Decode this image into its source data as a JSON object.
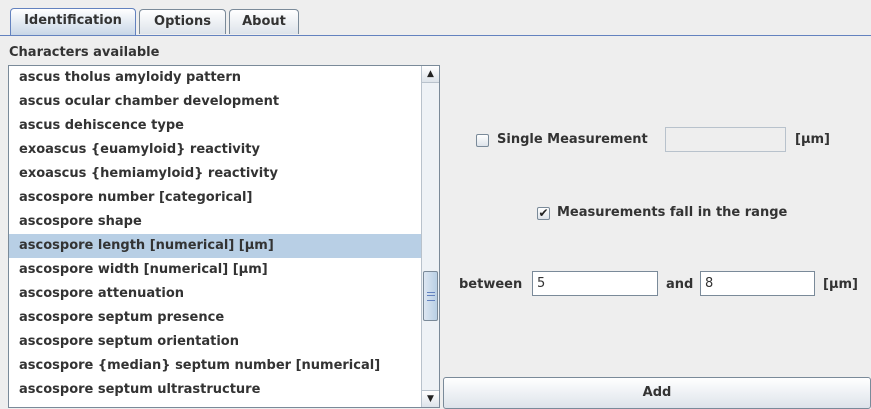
{
  "tabs": [
    {
      "label": "Identification",
      "active": true
    },
    {
      "label": "Options",
      "active": false
    },
    {
      "label": "About",
      "active": false
    }
  ],
  "characters_label": "Characters available",
  "characters": [
    "ascus tholus amyloidy pattern",
    "ascus ocular chamber development",
    "ascus dehiscence type",
    "exoascus {euamyloid} reactivity",
    "exoascus {hemiamyloid} reactivity",
    "ascospore number [categorical]",
    "ascospore shape",
    "ascospore length [numerical] [µm]",
    "ascospore width [numerical] [µm]",
    "ascospore attenuation",
    "ascospore septum presence",
    "ascospore septum orientation",
    "ascospore {median} septum number [numerical]",
    "ascospore septum ultrastructure"
  ],
  "selected_index": 7,
  "single_measurement": {
    "label": "Single Measurement",
    "checked": false,
    "value": "",
    "unit": "[µm]"
  },
  "range": {
    "label": "Measurements fall in the range",
    "checked": true,
    "between_label": "between",
    "from_value": "5",
    "and_label": "and",
    "to_value": "8",
    "unit": "[µm]"
  },
  "add_label": "Add"
}
